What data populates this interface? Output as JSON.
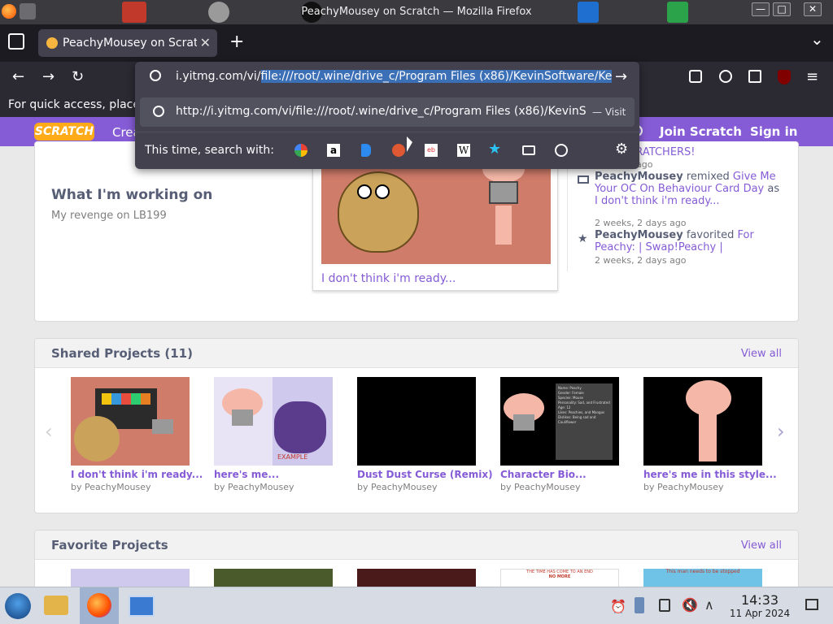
{
  "window": {
    "title": "PeachyMousey on Scratch — Mozilla Firefox",
    "buttons": {
      "minimize": "—",
      "maximize": "□",
      "close": "✕"
    }
  },
  "tabs": [
    {
      "label": "PeachyMousey on Scratc",
      "close": "✕"
    }
  ],
  "tabbar": {
    "new_tab": "+",
    "list_tabs": "⌄"
  },
  "urlbar": {
    "prefix": "i.yitmg.com/vi/",
    "selected": "file:///root/.wine/drive_c/Program Files (x86)/KevinSoftware/Ke",
    "go": "→"
  },
  "suggestion": {
    "url": "http://i.yitmg.com/vi/file:///root/.wine/drive_c/Program Files (x86)/KevinS",
    "action": "— Visit"
  },
  "search_with": {
    "label": "This time, search with:",
    "engines": [
      "google",
      "amazon",
      "bing",
      "duckduckgo",
      "ebay",
      "wikipedia",
      "bookmarks",
      "tabs",
      "history"
    ]
  },
  "bookmarks_bar": {
    "text": "For quick access, place"
  },
  "scratch": {
    "logo": "SCRATCH",
    "create": "Crea",
    "join": "Join Scratch",
    "signin": "Sign in"
  },
  "working_on": {
    "title": "What I'm working on",
    "subtitle": "My revenge on LB199",
    "project_title": "I don't think i'm ready..."
  },
  "activity": [
    {
      "text_tail": "THE SCRATCHERS!",
      "time": "minutes ago"
    },
    {
      "user": "PeachyMousey",
      "verb": "remixed",
      "project": "Give Me Your OC On Behaviour Card Day",
      "as": "as",
      "project2": "I don't think i'm ready...",
      "time": "2 weeks, 2 days ago"
    },
    {
      "user": "PeachyMousey",
      "verb": "favorited",
      "project": "For Peachy: | Swap!Peachy |",
      "time": "2 weeks, 2 days ago"
    }
  ],
  "shared": {
    "title": "Shared Projects (11)",
    "view_all": "View all",
    "projects": [
      {
        "title": "I don't think i'm ready...",
        "by": "by PeachyMousey"
      },
      {
        "title": "here's me...",
        "by": "by PeachyMousey"
      },
      {
        "title": "Dust Dust Curse (Remix)",
        "by": "by PeachyMousey"
      },
      {
        "title": "Character Bio...",
        "by": "by PeachyMousey"
      },
      {
        "title": "here's me in this style...",
        "by": "by PeachyMousey"
      }
    ]
  },
  "favorites": {
    "title": "Favorite Projects",
    "view_all": "View all"
  },
  "thumb_text": {
    "example": "EXAMPLE",
    "bio_lines": [
      "Name: Peachy",
      "Gender: Female",
      "Species: Mouse",
      "Personality: Sad, and Frustrated",
      "Age: 12",
      "Likes: Peachies, and Mangos",
      "Dislikes: Being sad and Cauliflower"
    ],
    "fav4_a": "THE TIME HAS COME TO AN END",
    "fav4_b": "NO MORE",
    "fav5": "This man needs to be stopped"
  },
  "taskbar": {
    "time": "14:33",
    "date": "11 Apr 2024"
  }
}
